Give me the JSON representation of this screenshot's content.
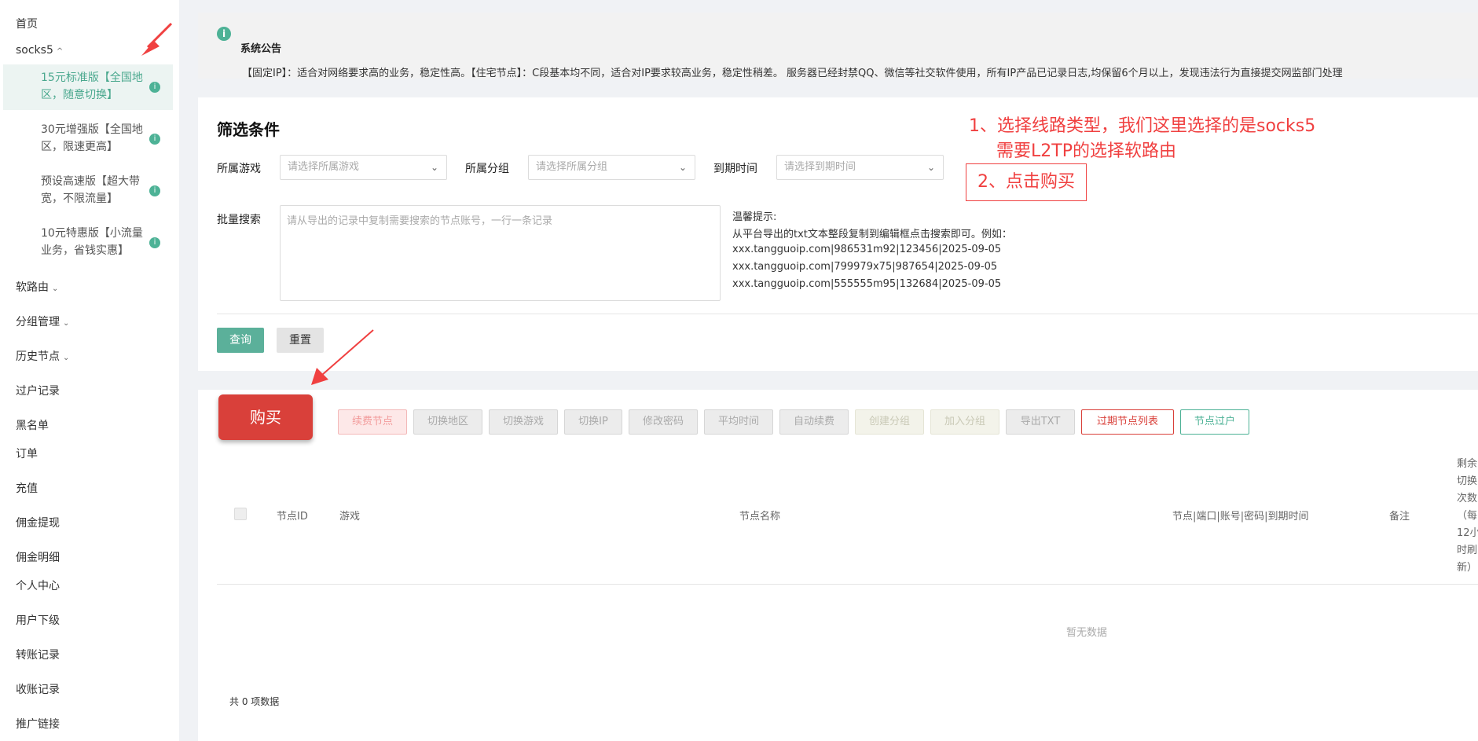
{
  "sidebar": {
    "items": [
      {
        "label": "首页"
      },
      {
        "label": "socks5",
        "chevron": "^"
      },
      {
        "label": "软路由",
        "chevron": "⌄"
      },
      {
        "label": "分组管理",
        "chevron": "⌄"
      },
      {
        "label": "历史节点",
        "chevron": "⌄"
      },
      {
        "label": "过户记录"
      },
      {
        "label": "黑名单"
      },
      {
        "label": "订单"
      },
      {
        "label": "充值"
      },
      {
        "label": "佣金提现"
      },
      {
        "label": "佣金明细"
      },
      {
        "label": "个人中心"
      },
      {
        "label": "用户下级"
      },
      {
        "label": "转账记录"
      },
      {
        "label": "收账记录"
      },
      {
        "label": "推广链接"
      }
    ],
    "sub_items": [
      {
        "label": "15元标准版【全国地区，随意切换】",
        "info": "i"
      },
      {
        "label": "30元增强版【全国地区，限速更高】",
        "info": "i"
      },
      {
        "label": "预设高速版【超大带宽，不限流量】",
        "info": "i"
      },
      {
        "label": "10元特惠版【小流量业务，省钱实惠】",
        "info": "i"
      }
    ]
  },
  "notice": {
    "icon": "i",
    "title": "系统公告",
    "text": "【固定IP】：适合对网络要求高的业务，稳定性高。【住宅节点】：C段基本均不同，适合对IP要求较高业务，稳定性稍差。 服务器已经封禁QQ、微信等社交软件使用，所有IP产品已记录日志,均保留6个月以上，发现违法行为直接提交网监部门处理"
  },
  "filter": {
    "title": "筛选条件",
    "game_label": "所属游戏",
    "game_placeholder": "请选择所属游戏",
    "group_label": "所属分组",
    "group_placeholder": "请选择所属分组",
    "expire_label": "到期时间",
    "expire_placeholder": "请选择到期时间",
    "batch_label": "批量搜索",
    "batch_placeholder": "请从导出的记录中复制需要搜索的节点账号，一行一条记录",
    "hint_title": "温馨提示:",
    "hint_line1": "从平台导出的txt文本整段复制到编辑框点击搜索即可。例如：",
    "hint_examples": [
      "xxx.tangguoip.com|986531m92|123456|2025-09-05",
      "xxx.tangguoip.com|799979x75|987654|2025-09-05",
      "xxx.tangguoip.com|555555m95|132684|2025-09-05"
    ],
    "query_label": "查询",
    "reset_label": "重置"
  },
  "toolbar": {
    "buy_label": "购买",
    "buttons": [
      {
        "label": "续费节点"
      },
      {
        "label": "切换地区"
      },
      {
        "label": "切换游戏"
      },
      {
        "label": "切换IP"
      },
      {
        "label": "修改密码"
      },
      {
        "label": "平均时间"
      },
      {
        "label": "自动续费"
      },
      {
        "label": "创建分组"
      },
      {
        "label": "加入分组"
      },
      {
        "label": "导出TXT"
      },
      {
        "label": "过期节点列表"
      },
      {
        "label": "节点过户"
      }
    ]
  },
  "table": {
    "headers": {
      "id": "节点ID",
      "game": "游戏",
      "name": "节点名称",
      "info": "节点|端口|账号|密码|到期时间",
      "remark": "备注",
      "remaining": [
        "剩余",
        "切换",
        "次数",
        "（每",
        "12小",
        "时刷",
        "新）"
      ]
    },
    "empty_text": "暂无数据",
    "total_text": "共 0 项数据"
  },
  "annotations": {
    "step1_line1": "1、选择线路类型，我们这里选择的是socks5",
    "step1_line2": "需要L2TP的选择软路由",
    "step2": "2、点击购买",
    "color": "#f04040"
  },
  "colors": {
    "accent": "#4db296",
    "buy": "#d9403a"
  }
}
